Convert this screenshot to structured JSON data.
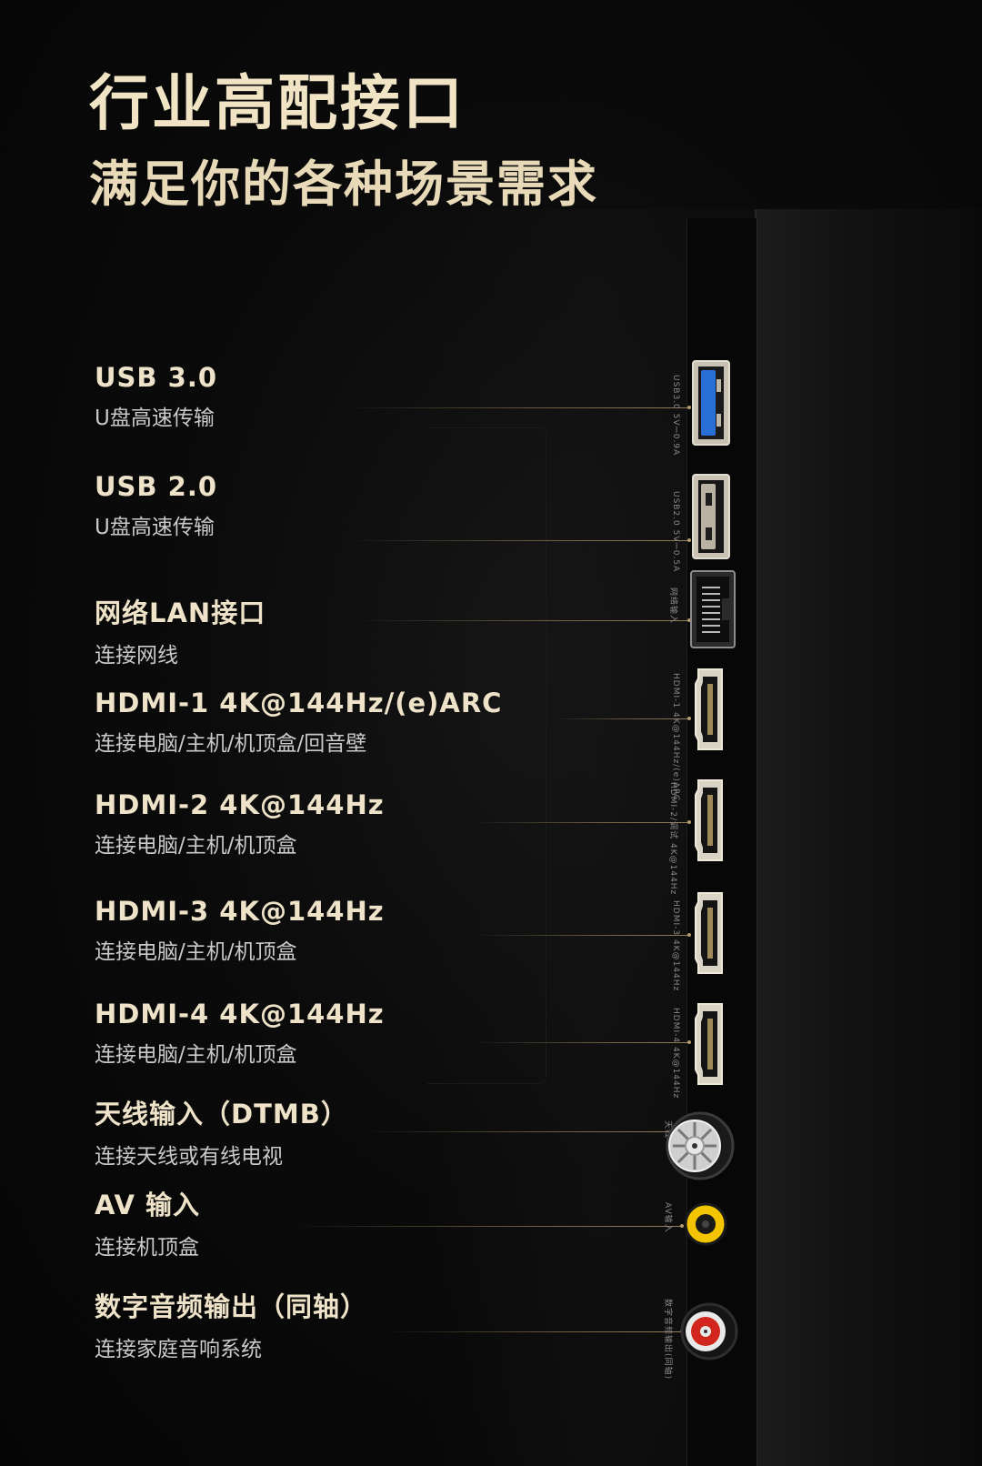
{
  "heading": {
    "title": "行业高配接口",
    "subtitle": "满足你的各种场景需求"
  },
  "ports": [
    {
      "title": "USB 3.0",
      "desc": "U盘高速传输",
      "icon": "usb3-port-icon",
      "print": "USB3.0 5V⎓0.9A"
    },
    {
      "title": "USB 2.0",
      "desc": "U盘高速传输",
      "icon": "usb2-port-icon",
      "print": "USB2.0 5V⎓0.5A"
    },
    {
      "title": "网络LAN接口",
      "desc": "连接网线",
      "icon": "lan-port-icon",
      "print": "网络输入"
    },
    {
      "title": "HDMI-1 4K@144Hz/(e)ARC",
      "desc": "连接电脑/主机/机顶盒/回音壁",
      "icon": "hdmi-port-icon",
      "print": "HDMI-1 4K@144Hz/(e)ARC"
    },
    {
      "title": "HDMI-2 4K@144Hz",
      "desc": "连接电脑/主机/机顶盒",
      "icon": "hdmi-port-icon",
      "print": "HDMI-2/调试 4K@144Hz"
    },
    {
      "title": "HDMI-3 4K@144Hz",
      "desc": "连接电脑/主机/机顶盒",
      "icon": "hdmi-port-icon",
      "print": "HDMI-3 4K@144Hz"
    },
    {
      "title": "HDMI-4 4K@144Hz",
      "desc": "连接电脑/主机/机顶盒",
      "icon": "hdmi-port-icon",
      "print": "HDMI-4 4K@144Hz"
    },
    {
      "title": "天线输入（DTMB）",
      "desc": "连接天线或有线电视",
      "icon": "antenna-port-icon",
      "print": "天线"
    },
    {
      "title": "AV 输入",
      "desc": "连接机顶盒",
      "icon": "av-port-icon",
      "print": "AV输入"
    },
    {
      "title": "数字音频输出（同轴）",
      "desc": "连接家庭音响系统",
      "icon": "coaxial-port-icon",
      "print": "数字音频输出(同轴)"
    }
  ],
  "colors": {
    "title": "#f1e4c4",
    "line": "#b59c70",
    "usb3_blue": "#2a6fd6",
    "av_yellow": "#f2c500",
    "coax_red": "#d0261e"
  }
}
